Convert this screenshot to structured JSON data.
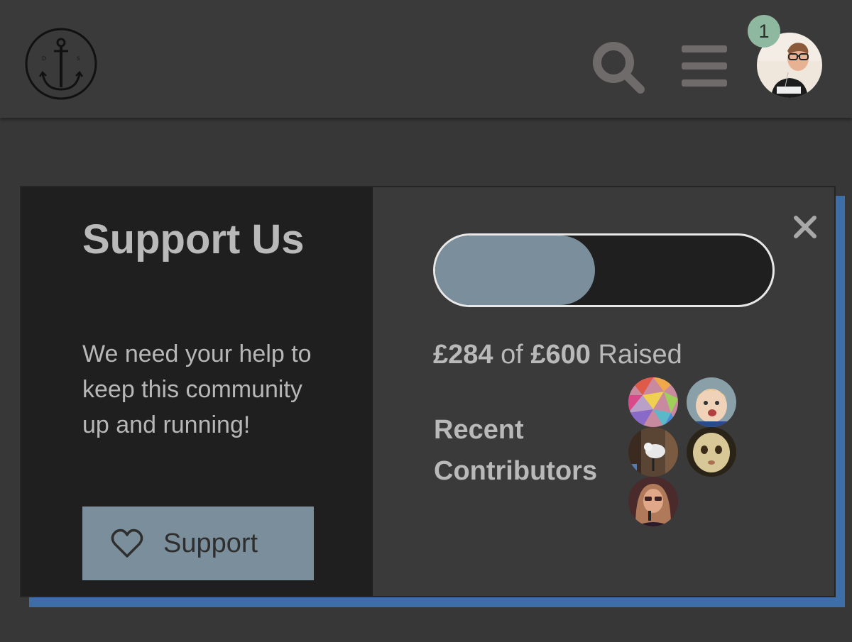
{
  "header": {
    "logo_icon": "anchor-logo-icon",
    "logo_letters": [
      "D",
      "S"
    ],
    "search_icon": "search-icon",
    "menu_icon": "hamburger-menu-icon",
    "notification_count": "1",
    "avatar_icon": "user-avatar"
  },
  "support_card": {
    "title": "Support Us",
    "description": "We need your help to keep this community up and running!",
    "button_label": "Support",
    "button_icon": "heart-icon",
    "close_icon": "close-icon",
    "progress": {
      "raised": "£284",
      "of_word": "of",
      "goal": "£600",
      "suffix": "Raised",
      "fraction": 0.473
    },
    "contributors_label": "Recent Contributors"
  },
  "colors": {
    "page_bg": "#373737",
    "panel_dark": "#1f1f1f",
    "accent": "#7a8f9b",
    "shadow_blue": "#3e6ea8",
    "badge": "#8fb8a0"
  }
}
